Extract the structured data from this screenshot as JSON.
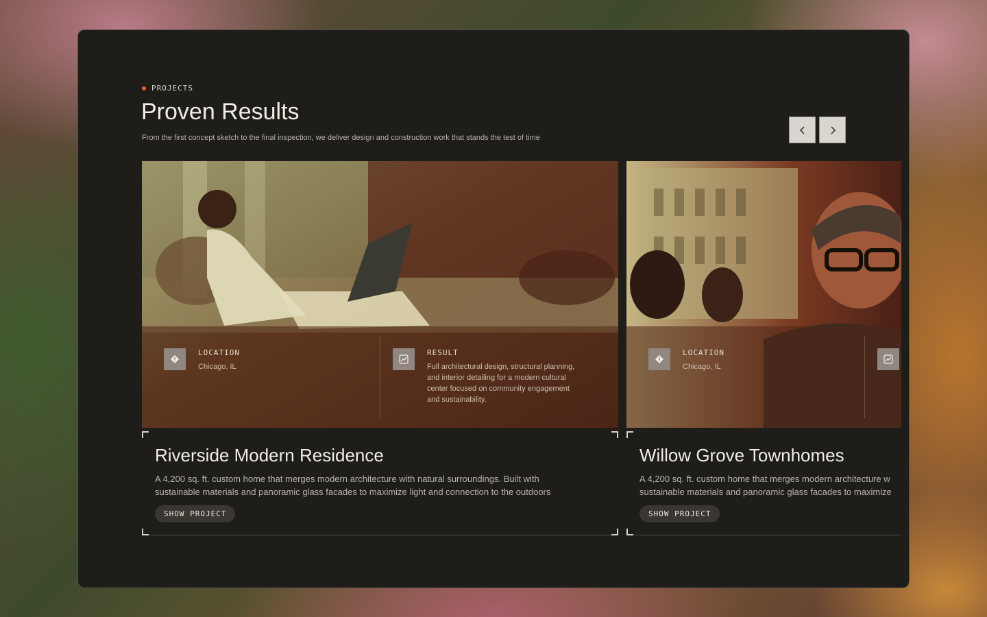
{
  "section": {
    "eyebrow": "PROJECTS",
    "title": "Proven Results",
    "subtitle": "From the first concept sketch to the final inspection, we deliver design and construction work that stands the test of time"
  },
  "nav": {
    "prev_icon": "chevron-left-icon",
    "next_icon": "chevron-right-icon"
  },
  "colors": {
    "accent": "#e8602c",
    "panel": "#1f1d1a",
    "text": "#f1ede4"
  },
  "projects": [
    {
      "title": "Riverside Modern Residence",
      "desc_line1": "A 4,200 sq. ft. custom home that merges modern architecture with natural surroundings. Built with",
      "desc_line2": "sustainable materials and panoramic glass facades to maximize light and connection to the outdoors",
      "location_label": "LOCATION",
      "location_value": "Chicago, IL",
      "result_label": "RESULT",
      "result_lines": [
        "Full architectural design, structural planning,",
        "and interior detailing for a modern cultural",
        "center focused on community engagement",
        "and sustainability."
      ],
      "button": "SHOW PROJECT"
    },
    {
      "title": "Willow Grove Townhomes",
      "desc_line1": "A 4,200 sq. ft. custom home that merges modern architecture w",
      "desc_line2": "sustainable materials and panoramic glass facades to maximize",
      "location_label": "LOCATION",
      "location_value": "Chicago, IL",
      "button": "SHOW PROJECT"
    }
  ]
}
